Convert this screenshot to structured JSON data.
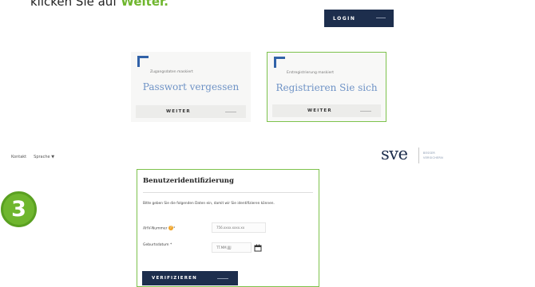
{
  "instruction": {
    "prefix": "klicken Sie auf ",
    "highlight": "Weiter."
  },
  "header": {
    "login_label": "LOGIN"
  },
  "cards": [
    {
      "small": "Zugangsdaten maskiert",
      "title": "Passwort vergessen",
      "button": "WEITER"
    },
    {
      "small": "Erstregistrierung maskiert",
      "title": "Registrieren Sie sich",
      "button": "WEITER"
    }
  ],
  "topnav": {
    "contact": "Kontakt",
    "language": "Sprache"
  },
  "logo": {
    "text": "sve",
    "sub_line1": "BESSER",
    "sub_line2": "VERSICHERN"
  },
  "step_badge": "3",
  "form": {
    "title": "Benutzeridentifizierung",
    "intro": "Bitte geben Sie die folgenden Daten ein, damit wir Sie identifizieren können.",
    "field1_label": "AHV-Nummer",
    "field1_required": "*",
    "field1_help": "?",
    "field1_placeholder": "756.xxxx.xxxx.xx",
    "field2_label": "Geburtsdatum",
    "field2_required": "*",
    "field2_placeholder": "TT.MM.JJJJ",
    "button": "VERIFIZIEREN"
  },
  "colors": {
    "accent_green": "#6fb62e",
    "navy": "#1d2e4d",
    "link_blue": "#6f93c6"
  },
  "icons": {
    "calendar": "calendar-icon",
    "caret": "chevron-down-icon",
    "help": "help-icon"
  }
}
